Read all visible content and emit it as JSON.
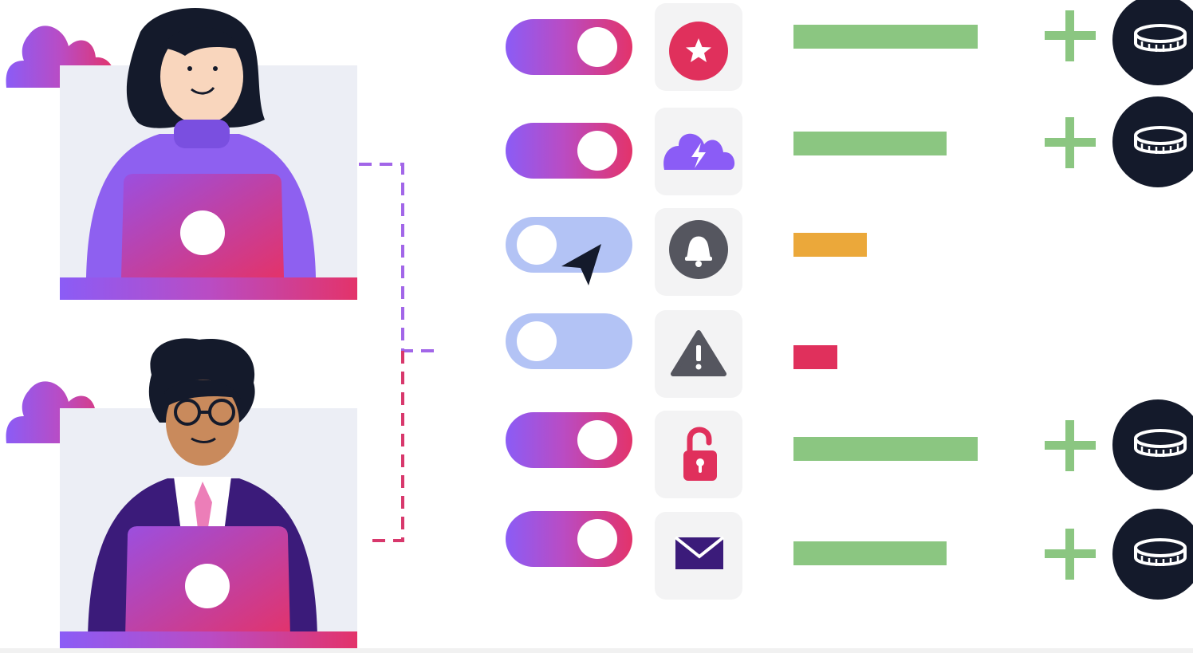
{
  "colors": {
    "purple": "#8b5cf6",
    "pink": "#e3336a",
    "green": "#8bc681",
    "orange": "#eba83a",
    "red": "#e0305c",
    "toggle_off": "#b3c3f5",
    "dark": "#141a2b"
  },
  "users": [
    {
      "icon": "woman-with-laptop"
    },
    {
      "icon": "man-with-laptop"
    }
  ],
  "settings": [
    {
      "icon": "star-icon",
      "enabled": true,
      "level": 1.0,
      "level_color": "green",
      "reward": true
    },
    {
      "icon": "cloud-lightning-icon",
      "enabled": true,
      "level": 0.83,
      "level_color": "green",
      "reward": true
    },
    {
      "icon": "bell-icon",
      "enabled": false,
      "level": 0.4,
      "level_color": "orange",
      "reward": false
    },
    {
      "icon": "warning-icon",
      "enabled": false,
      "level": 0.24,
      "level_color": "red",
      "reward": false
    },
    {
      "icon": "unlock-icon",
      "enabled": true,
      "level": 1.0,
      "level_color": "green",
      "reward": true
    },
    {
      "icon": "mail-icon",
      "enabled": true,
      "level": 0.83,
      "level_color": "green",
      "reward": true
    }
  ]
}
